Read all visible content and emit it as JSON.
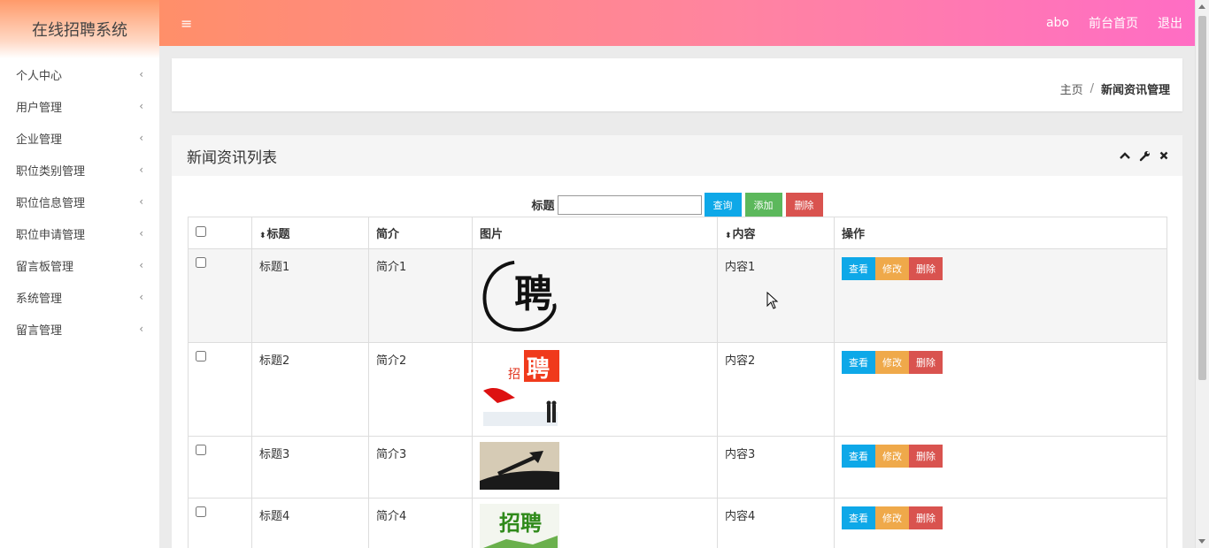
{
  "app": {
    "title": "在线招聘系统"
  },
  "sidebar": {
    "items": [
      {
        "label": "个人中心"
      },
      {
        "label": "用户管理"
      },
      {
        "label": "企业管理"
      },
      {
        "label": "职位类别管理"
      },
      {
        "label": "职位信息管理"
      },
      {
        "label": "职位申请管理"
      },
      {
        "label": "留言板管理"
      },
      {
        "label": "系统管理"
      },
      {
        "label": "留言管理"
      }
    ],
    "chevron": "‹"
  },
  "topbar": {
    "menu_icon": "≡",
    "user": "abo",
    "home_link": "前台首页",
    "logout": "退出"
  },
  "breadcrumb": {
    "home": "主页",
    "separator": "/",
    "current": "新闻资讯管理"
  },
  "list": {
    "title": "新闻资讯列表",
    "search": {
      "label": "标题",
      "value": "",
      "query": "查询",
      "add": "添加",
      "delete": "删除"
    },
    "columns": {
      "title": "标题",
      "summary": "简介",
      "image": "图片",
      "content": "内容",
      "actions": "操作"
    },
    "sort_icon": "⬍",
    "rows": [
      {
        "title": "标题1",
        "summary": "简介1",
        "content": "内容1",
        "image": "pin-circle"
      },
      {
        "title": "标题2",
        "summary": "简介2",
        "content": "内容2",
        "image": "zhaopin-red"
      },
      {
        "title": "标题3",
        "summary": "简介3",
        "content": "内容3",
        "image": "chart-arrow"
      },
      {
        "title": "标题4",
        "summary": "简介4",
        "content": "内容4",
        "image": "zhaopin-green"
      }
    ],
    "row_actions": {
      "view": "查看",
      "edit": "修改",
      "delete": "删除"
    }
  },
  "colors": {
    "accent_blue": "#0ea8e8",
    "success": "#5cb85c",
    "danger": "#d9534f",
    "warning": "#efa94a",
    "top_gradient_start": "#ff8f69",
    "top_gradient_end": "#ff6dc4"
  }
}
